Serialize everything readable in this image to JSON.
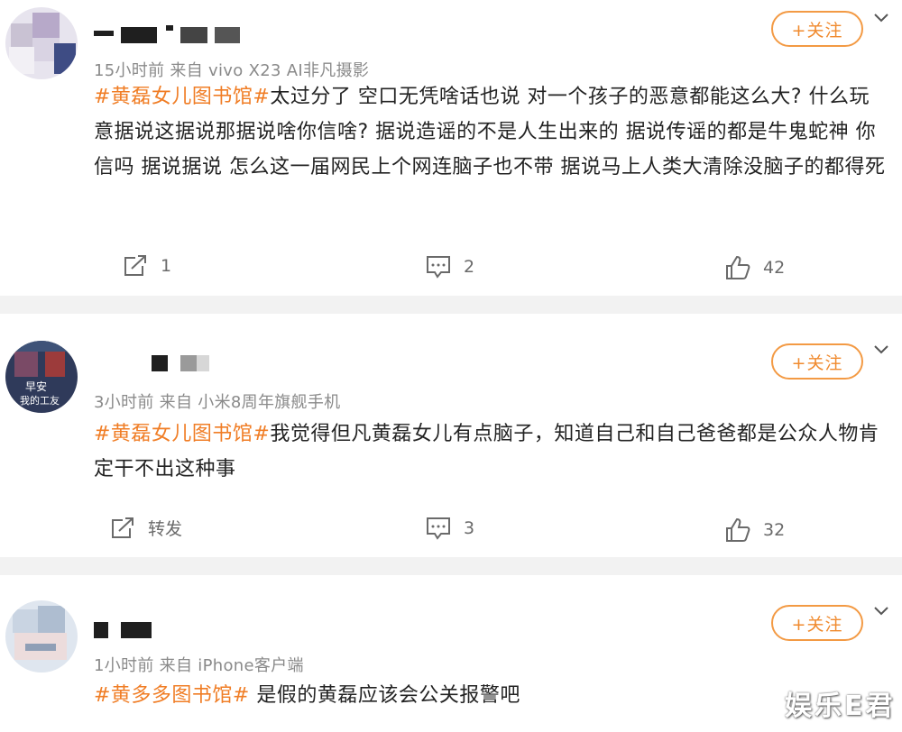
{
  "follow_label": "+关注",
  "comments": [
    {
      "meta": "15小时前  来自 vivo X23 AI非凡摄影",
      "hashtag": "#黄磊女儿图书馆#",
      "text": "太过分了 空口无凭啥话也说 对一个孩子的恶意都能这么大? 什么玩意据说这据说那据说啥你信啥? 据说造谣的不是人生出来的 据说传谣的都是牛鬼蛇神 你信吗 据说据说 怎么这一届网民上个网连脑子也不带 据说马上人类大清除没脑子的都得死",
      "repost": "1",
      "comments": "2",
      "likes": "42"
    },
    {
      "meta": "3小时前  来自 小米8周年旗舰手机",
      "hashtag": "#黄磊女儿图书馆#",
      "text": "我觉得但凡黄磊女儿有点脑子，知道自己和自己爸爸都是公众人物肯定干不出这种事",
      "avatar_text_1": "早安",
      "avatar_text_2": "我的工友",
      "repost": "转发",
      "comments": "3",
      "likes": "32"
    },
    {
      "meta": "1小时前  来自 iPhone客户端",
      "hashtag": "#黄多多图书馆#",
      "text": " 是假的黄磊应该会公关报警吧"
    }
  ],
  "watermark": "娱乐E君",
  "icons": {
    "repost": "repost-icon",
    "comment": "comment-icon",
    "like": "thumbs-up-icon",
    "expand": "chevron-down-icon"
  },
  "colors": {
    "accent": "#f08a2e",
    "hashtag": "#f07d25",
    "meta": "#8a8a8a",
    "divider": "#f2f2f2"
  }
}
